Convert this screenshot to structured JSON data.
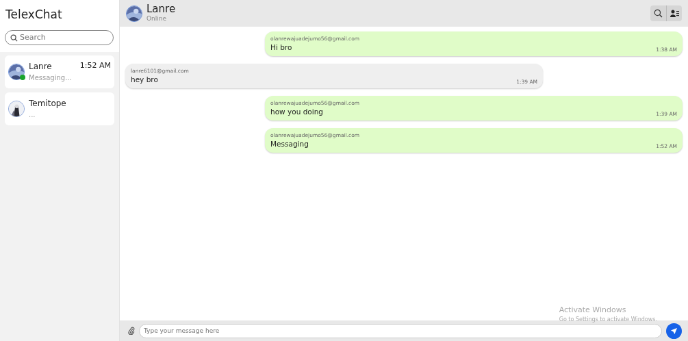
{
  "app_title": "TelexChat",
  "search": {
    "placeholder": "Search"
  },
  "contacts": [
    {
      "name": "Lanre",
      "preview": "Messaging...",
      "time": "1:52 AM",
      "online": true
    },
    {
      "name": "Temitope",
      "preview": "...",
      "online": false
    }
  ],
  "chat_header": {
    "name": "Lanre",
    "status": "Online"
  },
  "messages": [
    {
      "kind": "sent",
      "sender": "olanrewajuadejumo56@gmail.com",
      "text": "Hi bro",
      "time": "1:38 AM"
    },
    {
      "kind": "received",
      "sender": "lanre6101@gmail.com",
      "text": "hey bro",
      "time": "1:39 AM"
    },
    {
      "kind": "sent",
      "sender": "olanrewajuadejumo56@gmail.com",
      "text": "how you doing",
      "time": "1:39 AM"
    },
    {
      "kind": "sent",
      "sender": "olanrewajuadejumo56@gmail.com",
      "text": "Messaging",
      "time": "1:52 AM"
    }
  ],
  "composer": {
    "placeholder": "Type your message here"
  },
  "os_notice": {
    "title": "Activate Windows",
    "subtitle": "Go to Settings to activate Windows."
  }
}
